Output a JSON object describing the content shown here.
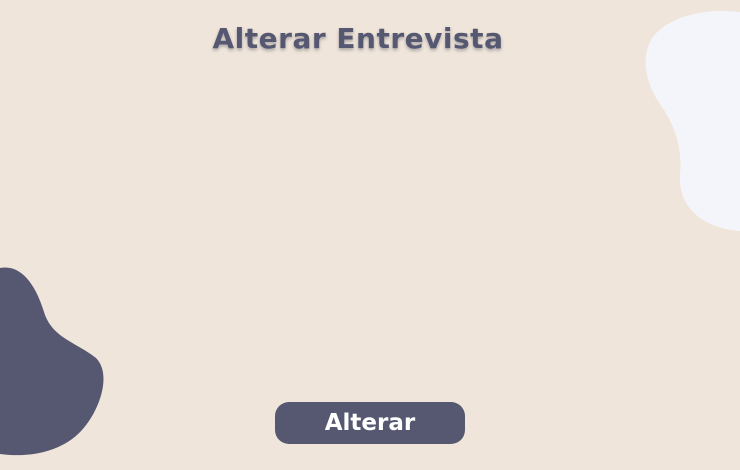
{
  "page": {
    "title": "Alterar Entrevista"
  },
  "form": {
    "submit_label": "Alterar"
  },
  "colors": {
    "background": "#EFE5DA",
    "primary": "#555870",
    "text_light": "#FFFFFF",
    "blob_light": "#F4F5FA",
    "blob_dark": "#555870"
  }
}
